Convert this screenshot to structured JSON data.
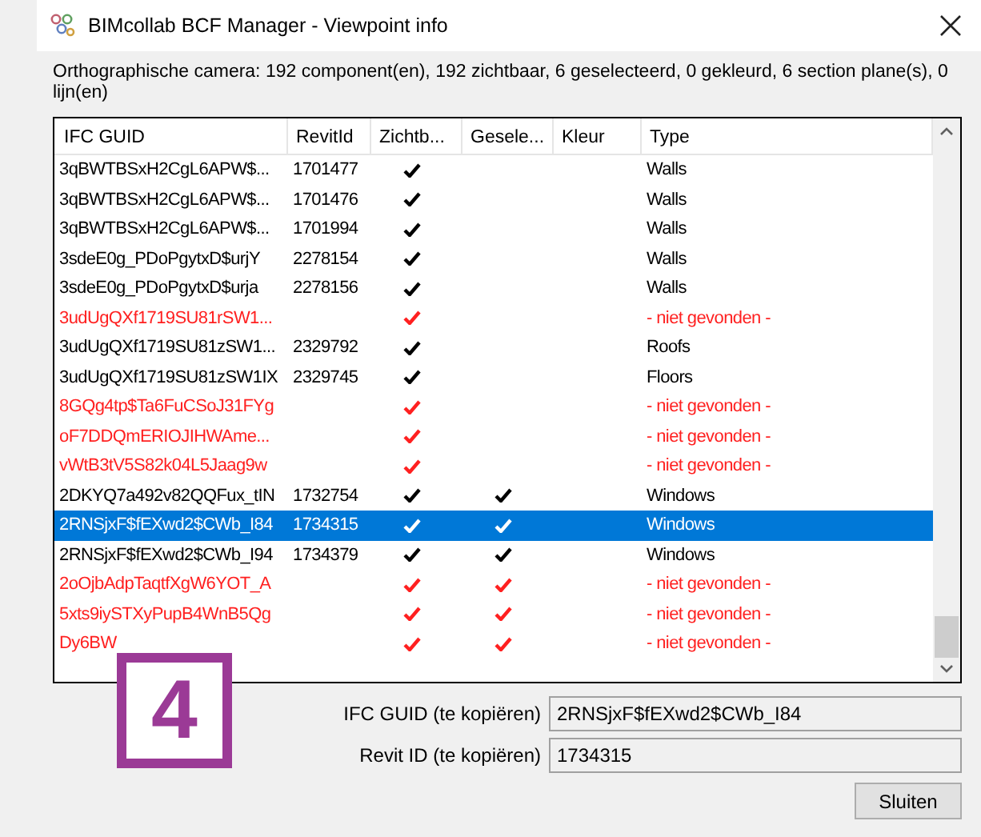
{
  "window": {
    "title": "BIMcollab BCF Manager - Viewpoint info"
  },
  "summary": "Orthographische camera: 192 component(en), 192 zichtbaar, 6 geselecteerd, 0 gekleurd, 6 section plane(s), 0 lijn(en)",
  "table": {
    "columns": [
      "IFC GUID",
      "RevitId",
      "Zichtb...",
      "Gesele...",
      "Kleur",
      "Type"
    ],
    "rows": [
      {
        "guid": "3qBWTBSxH2CgL6APW$...",
        "revit_id": "1701477",
        "visible": true,
        "in_selection": false,
        "type": "Walls",
        "missing": false,
        "selected": false
      },
      {
        "guid": "3qBWTBSxH2CgL6APW$...",
        "revit_id": "1701476",
        "visible": true,
        "in_selection": false,
        "type": "Walls",
        "missing": false,
        "selected": false
      },
      {
        "guid": "3qBWTBSxH2CgL6APW$...",
        "revit_id": "1701994",
        "visible": true,
        "in_selection": false,
        "type": "Walls",
        "missing": false,
        "selected": false
      },
      {
        "guid": "3sdeE0g_PDoPgytxD$urjY",
        "revit_id": "2278154",
        "visible": true,
        "in_selection": false,
        "type": "Walls",
        "missing": false,
        "selected": false
      },
      {
        "guid": "3sdeE0g_PDoPgytxD$urja",
        "revit_id": "2278156",
        "visible": true,
        "in_selection": false,
        "type": "Walls",
        "missing": false,
        "selected": false
      },
      {
        "guid": "3udUgQXf1719SU81rSW1...",
        "visible": true,
        "in_selection": false,
        "type": "- niet gevonden -",
        "missing": true,
        "selected": false
      },
      {
        "guid": "3udUgQXf1719SU81zSW1...",
        "revit_id": "2329792",
        "visible": true,
        "in_selection": false,
        "type": "Roofs",
        "missing": false,
        "selected": false
      },
      {
        "guid": "3udUgQXf1719SU81zSW1IX",
        "revit_id": "2329745",
        "visible": true,
        "in_selection": false,
        "type": "Floors",
        "missing": false,
        "selected": false
      },
      {
        "guid": "8GQg4tp$Ta6FuCSoJ31FYg",
        "visible": true,
        "in_selection": false,
        "type": "- niet gevonden -",
        "missing": true,
        "selected": false
      },
      {
        "guid": "oF7DDQmERIOJIHWAme...",
        "visible": true,
        "in_selection": false,
        "type": "- niet gevonden -",
        "missing": true,
        "selected": false
      },
      {
        "guid": "vWtB3tV5S82k04L5Jaag9w",
        "visible": true,
        "in_selection": false,
        "type": "- niet gevonden -",
        "missing": true,
        "selected": false
      },
      {
        "guid": "2DKYQ7a492v82QQFux_tIN",
        "revit_id": "1732754",
        "visible": true,
        "in_selection": true,
        "type": "Windows",
        "missing": false,
        "selected": false
      },
      {
        "guid": "2RNSjxF$fEXwd2$CWb_I84",
        "revit_id": "1734315",
        "visible": true,
        "in_selection": true,
        "type": "Windows",
        "missing": false,
        "selected": true
      },
      {
        "guid": "2RNSjxF$fEXwd2$CWb_I94",
        "revit_id": "1734379",
        "visible": true,
        "in_selection": true,
        "type": "Windows",
        "missing": false,
        "selected": false
      },
      {
        "guid": "2oOjbAdpTaqtfXgW6YOT_A",
        "visible": true,
        "in_selection": true,
        "type": "- niet gevonden -",
        "missing": true,
        "selected": false
      },
      {
        "guid": "5xts9iySTXyPupB4WnB5Qg",
        "visible": true,
        "in_selection": true,
        "type": "- niet gevonden -",
        "missing": true,
        "selected": false
      },
      {
        "guid": "Dy6BW",
        "visible": true,
        "in_selection": true,
        "type": "- niet gevonden -",
        "missing": true,
        "selected": false
      }
    ]
  },
  "fields": [
    {
      "label": "IFC GUID (te kopiëren)",
      "value": "2RNSjxF$fEXwd2$CWb_I84"
    },
    {
      "label": "Revit ID (te kopiëren)",
      "value": "1734315"
    }
  ],
  "buttons": [
    "Sluiten"
  ],
  "step_badge": "4"
}
